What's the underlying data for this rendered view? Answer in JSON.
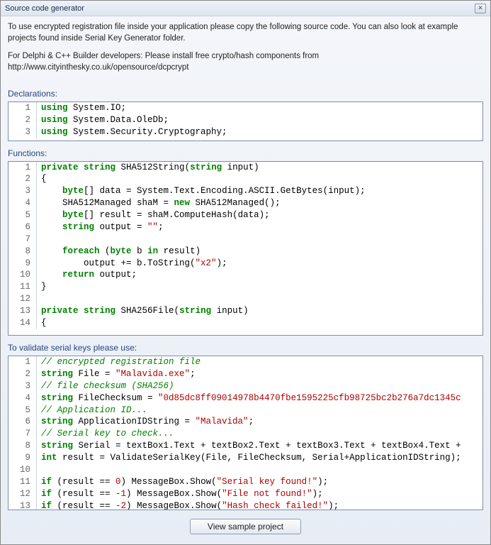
{
  "window": {
    "title": "Source code generator"
  },
  "intro": {
    "p1": "To use encrypted registration file inside your application please copy the following source code. You can also look at example projects found inside Serial Key Generator folder.",
    "p2": "For Delphi & C++ Builder developers: Please install free crypto/hash components from http://www.cityinthesky.co.uk/opensource/dcpcrypt"
  },
  "labels": {
    "declarations": "Declarations:",
    "functions": "Functions:",
    "validate": "To validate serial keys please use:"
  },
  "declarations": [
    {
      "n": "1",
      "tokens": [
        [
          "kw",
          "using"
        ],
        [
          "",
          " System.IO;"
        ]
      ]
    },
    {
      "n": "2",
      "tokens": [
        [
          "kw",
          "using"
        ],
        [
          "",
          " System.Data.OleDb;"
        ]
      ]
    },
    {
      "n": "3",
      "tokens": [
        [
          "kw",
          "using"
        ],
        [
          "",
          " System.Security.Cryptography;"
        ]
      ]
    }
  ],
  "functions": [
    {
      "n": "1",
      "tokens": [
        [
          "kw",
          "private"
        ],
        [
          "",
          " "
        ],
        [
          "kw",
          "string"
        ],
        [
          "",
          " SHA512String("
        ],
        [
          "kw",
          "string"
        ],
        [
          "",
          " input)"
        ]
      ]
    },
    {
      "n": "2",
      "tokens": [
        [
          "",
          "{"
        ]
      ]
    },
    {
      "n": "3",
      "tokens": [
        [
          "",
          "    "
        ],
        [
          "kw",
          "byte"
        ],
        [
          "",
          "[] data = System.Text.Encoding.ASCII.GetBytes(input);"
        ]
      ]
    },
    {
      "n": "4",
      "tokens": [
        [
          "",
          "    SHA512Managed shaM = "
        ],
        [
          "kw",
          "new"
        ],
        [
          "",
          " SHA512Managed();"
        ]
      ]
    },
    {
      "n": "5",
      "tokens": [
        [
          "",
          "    "
        ],
        [
          "kw",
          "byte"
        ],
        [
          "",
          "[] result = shaM.ComputeHash(data);"
        ]
      ]
    },
    {
      "n": "6",
      "tokens": [
        [
          "",
          "    "
        ],
        [
          "kw",
          "string"
        ],
        [
          "",
          " output = "
        ],
        [
          "str",
          "\"\""
        ],
        [
          "",
          ";"
        ]
      ]
    },
    {
      "n": "7",
      "tokens": [
        [
          "",
          ""
        ]
      ]
    },
    {
      "n": "8",
      "tokens": [
        [
          "",
          "    "
        ],
        [
          "kw",
          "foreach"
        ],
        [
          "",
          " ("
        ],
        [
          "kw",
          "byte"
        ],
        [
          "",
          " b "
        ],
        [
          "kw",
          "in"
        ],
        [
          "",
          " result)"
        ]
      ]
    },
    {
      "n": "9",
      "tokens": [
        [
          "",
          "        output += b.ToString("
        ],
        [
          "str",
          "\"x2\""
        ],
        [
          "",
          ");"
        ]
      ]
    },
    {
      "n": "10",
      "tokens": [
        [
          "",
          "    "
        ],
        [
          "kw",
          "return"
        ],
        [
          "",
          " output;"
        ]
      ]
    },
    {
      "n": "11",
      "tokens": [
        [
          "",
          "}"
        ]
      ]
    },
    {
      "n": "12",
      "tokens": [
        [
          "",
          ""
        ]
      ]
    },
    {
      "n": "13",
      "tokens": [
        [
          "kw",
          "private"
        ],
        [
          "",
          " "
        ],
        [
          "kw",
          "string"
        ],
        [
          "",
          " SHA256File("
        ],
        [
          "kw",
          "string"
        ],
        [
          "",
          " input)"
        ]
      ]
    },
    {
      "n": "14",
      "tokens": [
        [
          "",
          "{"
        ]
      ]
    }
  ],
  "validate": [
    {
      "n": "1",
      "tokens": [
        [
          "cmt",
          "// encrypted registration file"
        ]
      ]
    },
    {
      "n": "2",
      "tokens": [
        [
          "kw",
          "string"
        ],
        [
          "",
          " File = "
        ],
        [
          "str",
          "\"Malavida.exe\""
        ],
        [
          "",
          ";"
        ]
      ]
    },
    {
      "n": "3",
      "tokens": [
        [
          "cmt",
          "// file checksum (SHA256)"
        ]
      ]
    },
    {
      "n": "4",
      "tokens": [
        [
          "kw",
          "string"
        ],
        [
          "",
          " FileChecksum = "
        ],
        [
          "str",
          "\"0d85dc8ff09014978b4470fbe1595225cfb98725bc2b276a7dc1345c"
        ]
      ]
    },
    {
      "n": "5",
      "tokens": [
        [
          "cmt",
          "// Application ID..."
        ]
      ]
    },
    {
      "n": "6",
      "tokens": [
        [
          "kw",
          "string"
        ],
        [
          "",
          " ApplicationIDString = "
        ],
        [
          "str",
          "\"Malavida\""
        ],
        [
          "",
          ";"
        ]
      ]
    },
    {
      "n": "7",
      "tokens": [
        [
          "cmt",
          "// Serial key to check..."
        ]
      ]
    },
    {
      "n": "8",
      "tokens": [
        [
          "kw",
          "string"
        ],
        [
          "",
          " Serial = textBox1.Text + textBox2.Text + textBox3.Text + textBox4.Text +"
        ]
      ]
    },
    {
      "n": "9",
      "tokens": [
        [
          "kw",
          "int"
        ],
        [
          "",
          " result = ValidateSerialKey(File, FileChecksum, Serial+ApplicationIDString);"
        ]
      ]
    },
    {
      "n": "10",
      "tokens": [
        [
          "",
          ""
        ]
      ]
    },
    {
      "n": "11",
      "tokens": [
        [
          "kw",
          "if"
        ],
        [
          "",
          " (result == "
        ],
        [
          "num",
          "0"
        ],
        [
          "",
          ") MessageBox.Show("
        ],
        [
          "str",
          "\"Serial key found!\""
        ],
        [
          "",
          ");"
        ]
      ]
    },
    {
      "n": "12",
      "tokens": [
        [
          "kw",
          "if"
        ],
        [
          "",
          " (result == "
        ],
        [
          "num",
          "-1"
        ],
        [
          "",
          ") MessageBox.Show("
        ],
        [
          "str",
          "\"File not found!\""
        ],
        [
          "",
          ");"
        ]
      ]
    },
    {
      "n": "13",
      "tokens": [
        [
          "kw",
          "if"
        ],
        [
          "",
          " (result == "
        ],
        [
          "num",
          "-2"
        ],
        [
          "",
          ") MessageBox.Show("
        ],
        [
          "str",
          "\"Hash check failed!\""
        ],
        [
          "",
          ");"
        ]
      ]
    }
  ],
  "footer": {
    "button": "View sample project"
  }
}
